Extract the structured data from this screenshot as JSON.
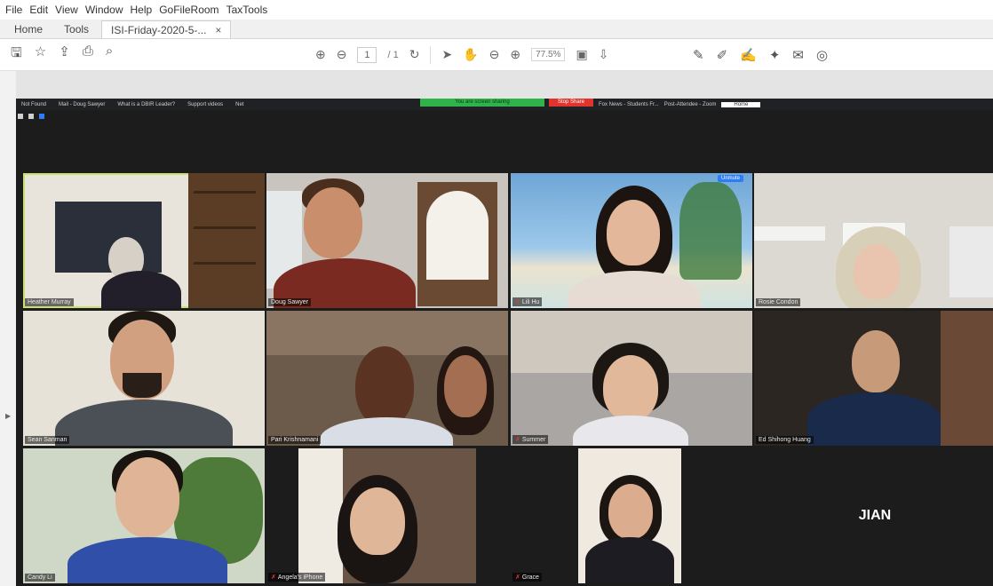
{
  "menubar": {
    "items": [
      "File",
      "Edit",
      "View",
      "Window",
      "Help",
      "GoFileRoom",
      "TaxTools"
    ]
  },
  "tabs": {
    "home": "Home",
    "tools": "Tools",
    "document": "ISI-Friday-2020-5-...",
    "close_symbol": "×"
  },
  "toolbar": {
    "page_current": "1",
    "page_total": "/ 1",
    "zoom": "77.5%"
  },
  "browser": {
    "tabs": [
      "Not Found",
      "Mail - Doug Sawyer",
      "What is a DBIR Leader?",
      "Support videos",
      "Net",
      "Fox News - Students Fr...",
      "Post-Attendee - Zoom",
      "Home"
    ],
    "share_text": "You are screen sharing",
    "stop_share": "Stop Share"
  },
  "participants": [
    {
      "name": "Heather Murray",
      "muted": false
    },
    {
      "name": "Doug Sawyer",
      "muted": false
    },
    {
      "name": "Lili Hu",
      "muted": true
    },
    {
      "name": "Rosie Condon",
      "muted": false
    },
    {
      "name": "Sean Sanman",
      "muted": false
    },
    {
      "name": "Pari Krishnamani",
      "muted": false
    },
    {
      "name": "Summer",
      "muted": true
    },
    {
      "name": "Ed Shihong Huang",
      "muted": false
    },
    {
      "name": "Candy Li",
      "muted": false
    },
    {
      "name": "Angela's iPhone",
      "muted": true
    },
    {
      "name": "Grace",
      "muted": true
    },
    {
      "name": "JIAN",
      "muted": false
    }
  ],
  "badge": "Unmute",
  "colors": {
    "share_green": "#2fb34a",
    "stop_red": "#e0342c",
    "active_speaker": "#c8e06c",
    "zoom_blue": "#2e7df6"
  }
}
